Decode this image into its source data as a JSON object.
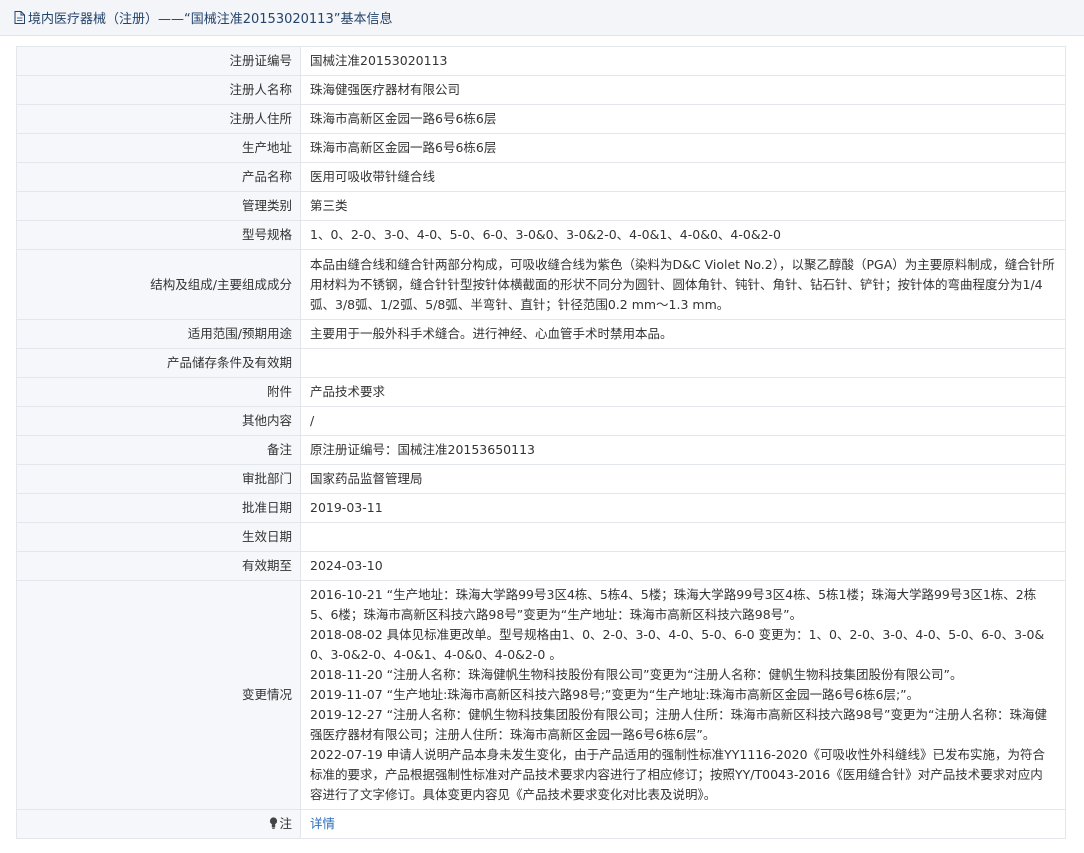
{
  "header": {
    "title": "境内医疗器械（注册）——“国械注准20153020113”基本信息"
  },
  "rows": [
    {
      "label": "注册证编号",
      "value": "国械注准20153020113"
    },
    {
      "label": "注册人名称",
      "value": "珠海健强医疗器材有限公司"
    },
    {
      "label": "注册人住所",
      "value": "珠海市高新区金园一路6号6栋6层"
    },
    {
      "label": "生产地址",
      "value": "珠海市高新区金园一路6号6栋6层"
    },
    {
      "label": "产品名称",
      "value": "医用可吸收带针缝合线"
    },
    {
      "label": "管理类别",
      "value": "第三类"
    },
    {
      "label": "型号规格",
      "value": "1、0、2-0、3-0、4-0、5-0、6-0、3-0&0、3-0&2-0、4-0&1、4-0&0、4-0&2-0"
    },
    {
      "label": "结构及组成/主要组成成分",
      "value": "本品由缝合线和缝合针两部分构成，可吸收缝合线为紫色（染料为D&C Violet No.2），以聚乙醇酸（PGA）为主要原料制成，缝合针所用材料为不锈钢，缝合针针型按针体横截面的形状不同分为圆针、圆体角针、钝针、角针、钻石针、铲针；按针体的弯曲程度分为1/4弧、3/8弧、1/2弧、5/8弧、半弯针、直针；针径范围0.2 mm～1.3 mm。"
    },
    {
      "label": "适用范围/预期用途",
      "value": "主要用于一般外科手术缝合。进行神经、心血管手术时禁用本品。"
    },
    {
      "label": "产品储存条件及有效期",
      "value": ""
    },
    {
      "label": "附件",
      "value": "产品技术要求"
    },
    {
      "label": "其他内容",
      "value": "/"
    },
    {
      "label": "备注",
      "value": "原注册证编号：国械注准20153650113"
    },
    {
      "label": "审批部门",
      "value": "国家药品监督管理局"
    },
    {
      "label": "批准日期",
      "value": "2019-03-11"
    },
    {
      "label": "生效日期",
      "value": ""
    },
    {
      "label": "有效期至",
      "value": "2024-03-10"
    }
  ],
  "changes": {
    "label": "变更情况",
    "items": [
      "2016-10-21 “生产地址：珠海大学路99号3区4栋、5栋4、5楼；珠海大学路99号3区4栋、5栋1楼；珠海大学路99号3区1栋、2栋5、6楼；珠海市高新区科技六路98号”变更为“生产地址：珠海市高新区科技六路98号”。",
      "2018-08-02 具体见标准更改单。型号规格由1、0、2-0、3-0、4-0、5-0、6-0 变更为：1、0、2-0、3-0、4-0、5-0、6-0、3-0&0、3-0&2-0、4-0&1、4-0&0、4-0&2-0 。",
      "2018-11-20 “注册人名称：珠海健帆生物科技股份有限公司”变更为“注册人名称：健帆生物科技集团股份有限公司”。",
      "2019-11-07 “生产地址:珠海市高新区科技六路98号;”变更为“生产地址:珠海市高新区金园一路6号6栋6层;”。",
      "2019-12-27 “注册人名称：健帆生物科技集团股份有限公司；注册人住所：珠海市高新区科技六路98号”变更为“注册人名称：珠海健强医疗器材有限公司；注册人住所：珠海市高新区金园一路6号6栋6层”。",
      "2022-07-19 申请人说明产品本身未发生变化，由于产品适用的强制性标准YY1116-2020《可吸收性外科缝线》已发布实施，为符合标准的要求，产品根据强制性标准对产品技术要求内容进行了相应修订；按照YY/T0043-2016《医用缝合针》对产品技术要求对应内容进行了文字修订。具体变更内容见《产品技术要求变化对比表及说明》。"
    ]
  },
  "note": {
    "label": "注",
    "link_text": "详情"
  },
  "colors": {
    "header_bg": "#f3f5f9",
    "label_bg": "#f5f7fa",
    "border": "#e3e6eb",
    "title_text": "#24446b",
    "link": "#2a6dbb"
  }
}
